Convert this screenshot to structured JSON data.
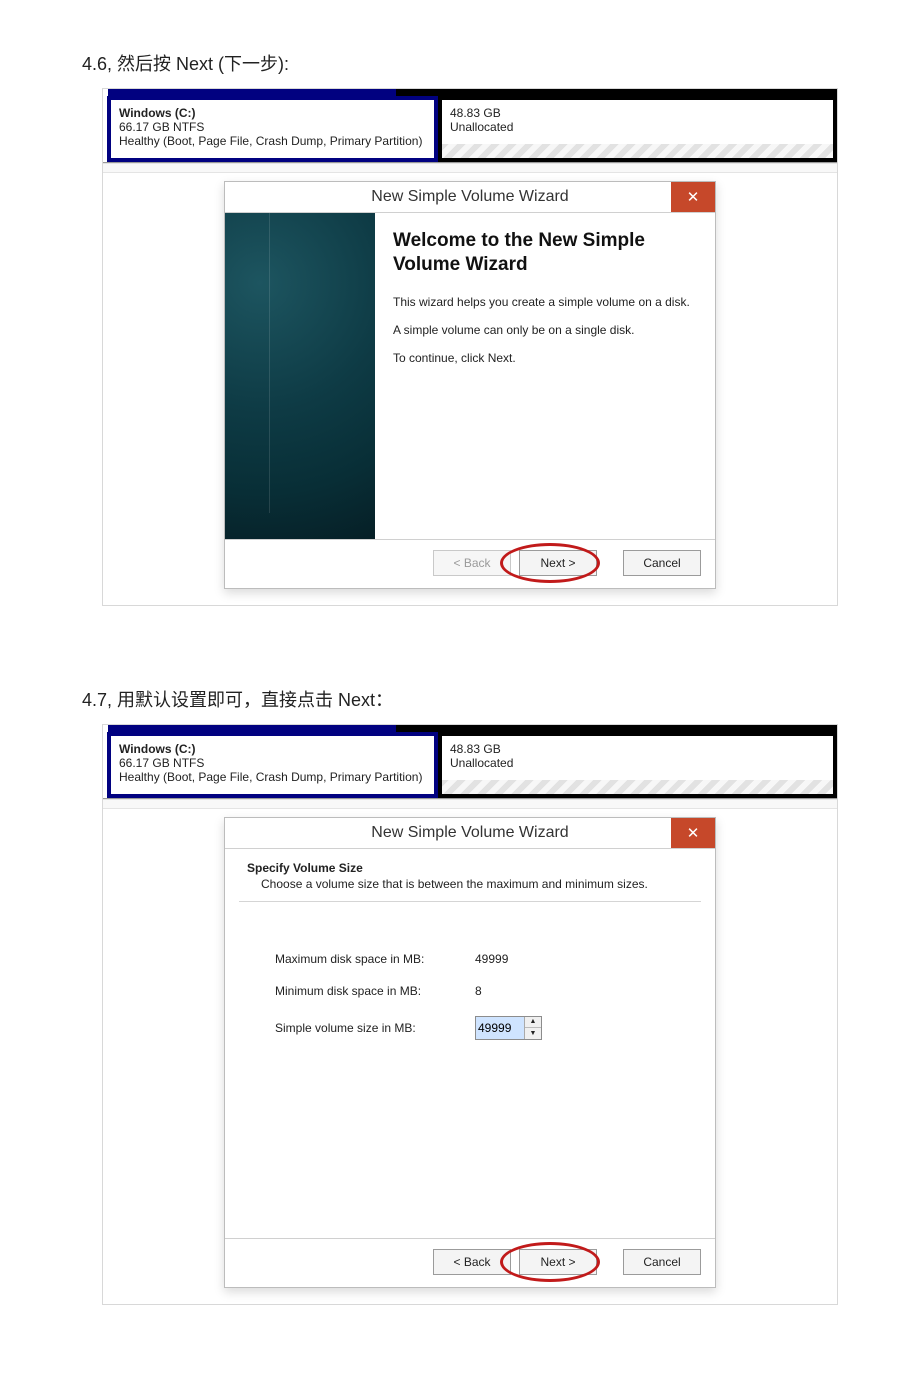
{
  "captions": {
    "s46": "4.6, 然后按 Next (下一步):",
    "s47": "4.7, 用默认设置即可，直接点击 Next："
  },
  "disk": {
    "left": {
      "title": "Windows  (C:)",
      "size": "66.17 GB NTFS",
      "status": "Healthy (Boot, Page File, Crash Dump, Primary Partition)"
    },
    "right": {
      "size": "48.83 GB",
      "status": "Unallocated"
    }
  },
  "dialog": {
    "title": "New Simple Volume Wizard",
    "close": "✕",
    "buttons": {
      "back": "< Back",
      "next": "Next >",
      "cancel": "Cancel"
    }
  },
  "step46": {
    "heading": "Welcome to the New Simple Volume Wizard",
    "p1": "This wizard helps you create a simple volume on a disk.",
    "p2": "A simple volume can only be on a single disk.",
    "p3": "To continue, click Next."
  },
  "step47": {
    "heading": "Specify Volume Size",
    "sub": "Choose a volume size that is between the maximum and minimum sizes.",
    "rows": {
      "max": {
        "label": "Maximum disk space in MB:",
        "value": "49999"
      },
      "min": {
        "label": "Minimum disk space in MB:",
        "value": "8"
      },
      "size": {
        "label": "Simple volume size in MB:",
        "value": "49999"
      }
    }
  }
}
